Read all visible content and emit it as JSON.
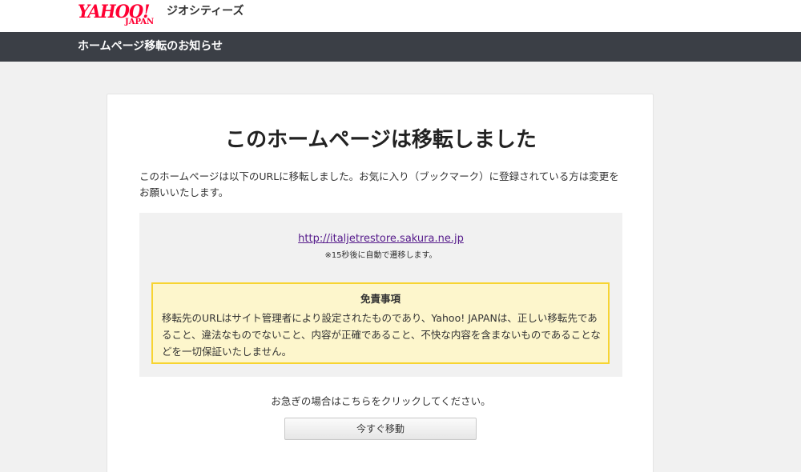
{
  "header": {
    "logo_main": "YAHOO!",
    "logo_sub": "JAPAN",
    "service_name": "ジオシティーズ"
  },
  "nav": {
    "title": "ホームページ移転のお知らせ"
  },
  "main": {
    "title": "このホームページは移転しました",
    "description": "このホームページは以下のURLに移転しました。お気に入り（ブックマーク）に登録されている方は変更をお願いいたします。",
    "redirect_url": "http://italjetrestore.sakura.ne.jp",
    "redirect_note": "※15秒後に自動で遷移します。",
    "disclaimer": {
      "title": "免責事項",
      "text": "移転先のURLはサイト管理者により設定されたものであり、Yahoo! JAPANは、正しい移転先であること、違法なものでないこと、内容が正確であること、不快な内容を含まないものであることなどを一切保証いたしません。"
    },
    "hurry_text": "お急ぎの場合はこちらをクリックしてください。",
    "move_button_label": "今すぐ移動"
  },
  "colors": {
    "brand_red": "#ff0033",
    "nav_bg": "#3b3f46",
    "page_bg": "#f1f1f1",
    "link": "#551a8b",
    "disclaimer_bg": "#fdf6cc",
    "disclaimer_border": "#f7d431"
  }
}
